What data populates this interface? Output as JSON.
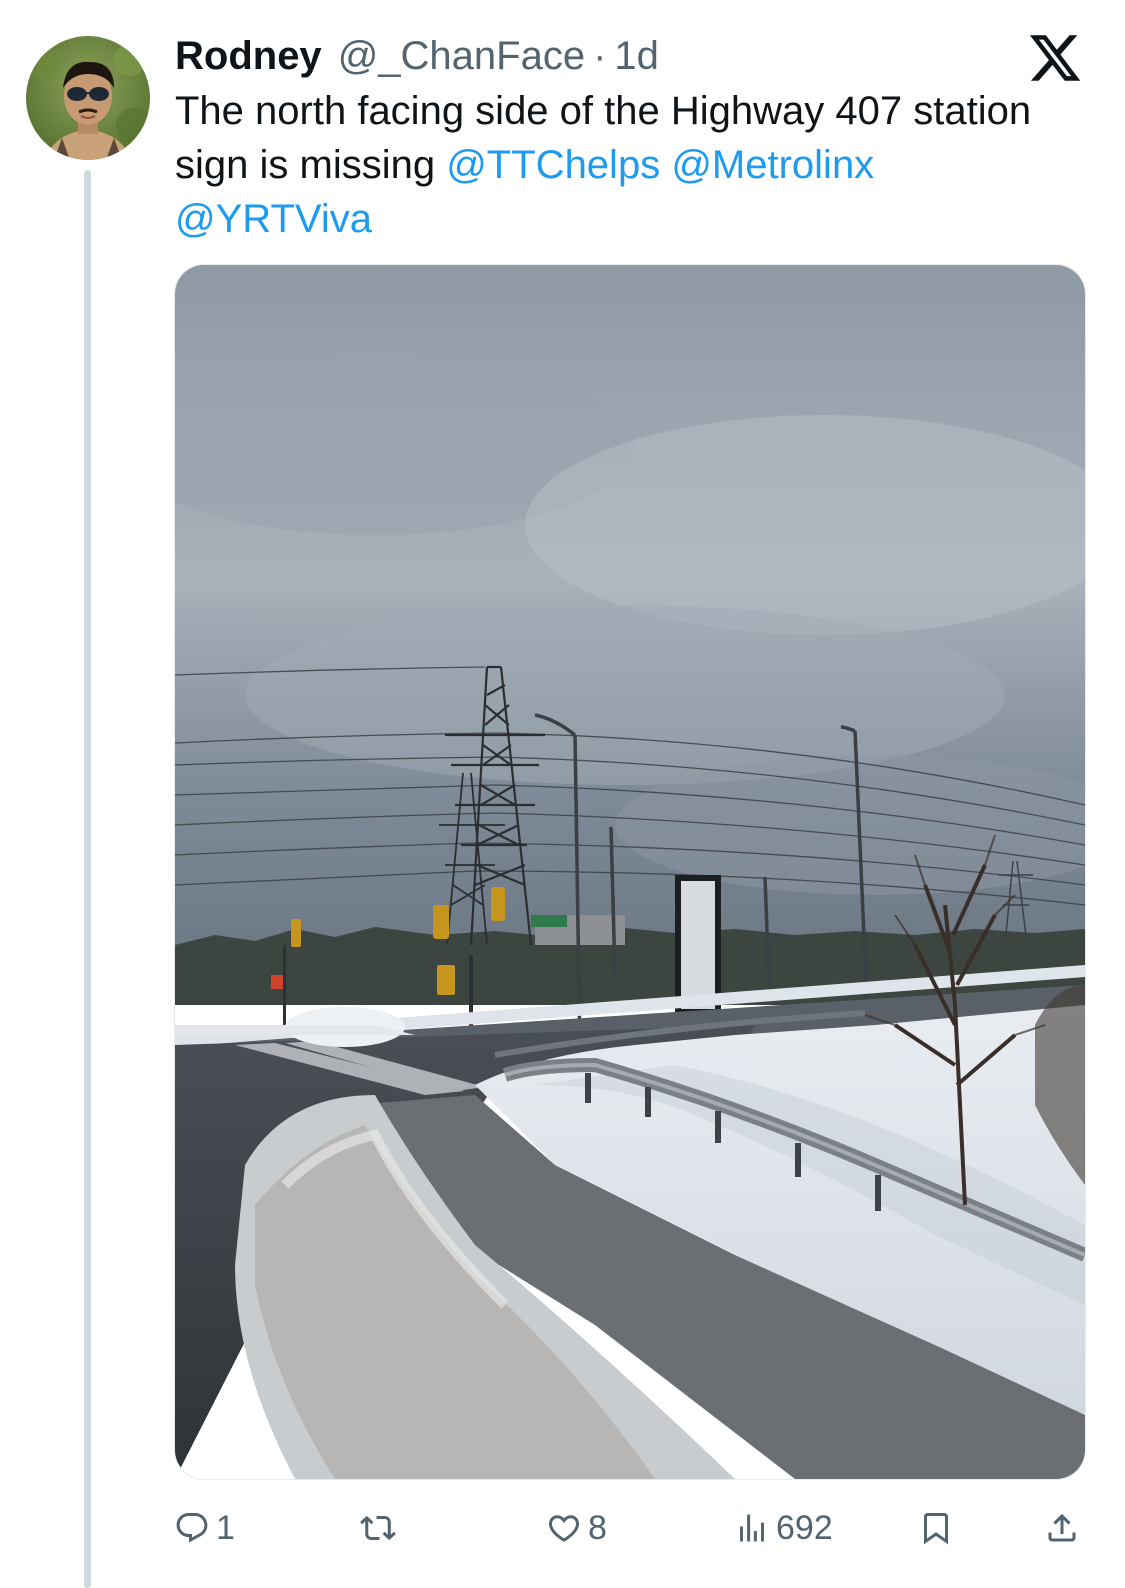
{
  "tweet": {
    "display_name": "Rodney",
    "handle": "@_ChanFace",
    "separator": "·",
    "time": "1d",
    "text_part1": "The north facing side of the Highway 407 station sign is missing ",
    "mention1": "@TTChelps",
    "mention2": "@Metrolinx",
    "mention3": "@YRTViva",
    "media_alt": "Snowy roadside next to a highway ramp with hydro towers and an overcast sky"
  },
  "actions": {
    "reply_count": "1",
    "retweet_count": "",
    "like_count": "8",
    "view_count": "692"
  },
  "icons": {
    "logo": "x-logo-icon",
    "reply": "reply-icon",
    "retweet": "retweet-icon",
    "like": "heart-icon",
    "views": "views-icon",
    "bookmark": "bookmark-icon",
    "share": "share-icon"
  },
  "colors": {
    "text": "#0f1419",
    "secondary": "#536471",
    "link": "#1d9bf0",
    "thread_line": "#cfd9de"
  }
}
